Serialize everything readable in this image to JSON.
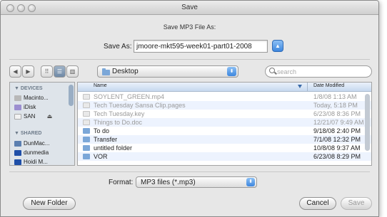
{
  "window": {
    "title": "Save"
  },
  "dialog": {
    "prompt": "Save MP3 File As:",
    "save_as_label": "Save As:",
    "save_as_value": "jmoore-mkt595-week01-part01-2008"
  },
  "toolbar": {
    "back": "◀",
    "forward": "▶",
    "view_icons": "⠿",
    "view_list": "☰",
    "view_columns": "▥",
    "location": "Desktop",
    "search_placeholder": "search"
  },
  "sidebar": {
    "devices_header": "▼ DEVICES",
    "devices": [
      "Macinto...",
      "iDisk",
      "SAN"
    ],
    "shared_header": "▼ SHARED",
    "shared": [
      "DunMac...",
      "dunmedia",
      "Hoidi M..."
    ]
  },
  "file_list": {
    "columns": {
      "name": "Name",
      "date": "Date Modified"
    },
    "rows": [
      {
        "name": "SOYLENT_GREEN.mp4",
        "date": "1/8/08 1:13 AM",
        "dim": true,
        "type": "doc"
      },
      {
        "name": "Tech Tuesday Sansa Clip.pages",
        "date": "Today, 5:18 PM",
        "dim": true,
        "type": "doc"
      },
      {
        "name": "Tech Tuesday.key",
        "date": "6/23/08 8:36 PM",
        "dim": true,
        "type": "doc"
      },
      {
        "name": "Things to Do.doc",
        "date": "12/21/07 9:49 AM",
        "dim": true,
        "type": "doc"
      },
      {
        "name": "To do",
        "date": "9/18/08 2:40 PM",
        "dim": false,
        "type": "folder"
      },
      {
        "name": "Transfer",
        "date": "7/1/08 12:32 PM",
        "dim": false,
        "type": "folder"
      },
      {
        "name": "untitled folder",
        "date": "10/8/08 9:37 AM",
        "dim": false,
        "type": "folder"
      },
      {
        "name": "VOR",
        "date": "6/23/08 8:29 PM",
        "dim": false,
        "type": "folder"
      }
    ]
  },
  "format": {
    "label": "Format:",
    "value": "MP3 files (*.mp3)"
  },
  "buttons": {
    "new_folder": "New Folder",
    "cancel": "Cancel",
    "save": "Save"
  },
  "colors": {
    "accent": "#3d86de",
    "row_alt": "#edf3fe",
    "sidebar_bg": "#dee4ea"
  }
}
